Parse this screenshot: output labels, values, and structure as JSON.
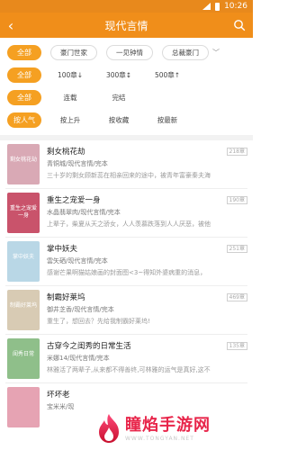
{
  "status": {
    "time": "10:26"
  },
  "header": {
    "title": "现代言情"
  },
  "filters": [
    {
      "label": "全部",
      "options": [
        "豪门世家",
        "一见钟情",
        "总裁豪门"
      ],
      "has_more": true
    },
    {
      "label": "全部",
      "options": [
        "100章↓",
        "300章↕",
        "500章↑"
      ],
      "has_more": false
    },
    {
      "label": "全部",
      "options": [
        "连载",
        "完结"
      ],
      "has_more": false
    },
    {
      "label": "按人气",
      "options": [
        "按上升",
        "按收藏",
        "按最新"
      ],
      "has_more": false
    }
  ],
  "books": [
    {
      "title": "剩女桃花劫",
      "chapters": "218章",
      "meta": "青铜城/现代言情/完本",
      "desc": "三十岁的剩女顾新蕊在相亲回来的途中，被青年富豪秦夫海",
      "cover_text": "剩女桃花劫",
      "cover_color": "#d9a9b5"
    },
    {
      "title": "重生之宠爱一身",
      "chapters": "190章",
      "meta": "水晶翡翠肉/现代言情/完本",
      "desc": "上辈子，柴夏从天之骄女，人人羡慕跌落到人人厌恶，被他",
      "cover_text": "重生之宠爱一身",
      "cover_color": "#c9536b"
    },
    {
      "title": "掌中妖夫",
      "chapters": "251章",
      "meta": "雲矢硒/现代言情/完本",
      "desc": "感谢芒果啊猫姑娘画的封面图<3~得知外婆病重的消息，",
      "cover_text": "掌中妖夫",
      "cover_color": "#b9d7e6"
    },
    {
      "title": "制霸好莱坞",
      "chapters": "469章",
      "meta": "御井芝香/现代言情/完本",
      "desc": "重生了，想回去？先给我制霸好莱坞!",
      "cover_text": "制霸好莱坞",
      "cover_color": "#d8cbb4"
    },
    {
      "title": "古穿今之闺秀的日常生活",
      "chapters": "135章",
      "meta": "米娜14/现代言情/完本",
      "desc": "林雅活了两辈子,从来都不得善终,可林雅的运气是真好,这不",
      "cover_text": "闺秀日常",
      "cover_color": "#8fbf8a"
    },
    {
      "title": "坏坏老",
      "chapters": "",
      "meta": "宝米米/现",
      "desc": "",
      "cover_text": "",
      "cover_color": "#e6a3b3"
    }
  ],
  "watermark": {
    "name": "瞳焰手游网",
    "url": "WWW.TONGYAN.NET"
  }
}
